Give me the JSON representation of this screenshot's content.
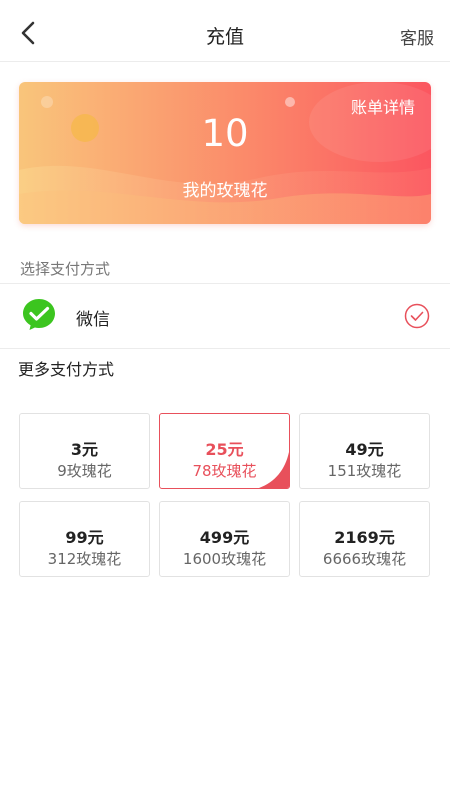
{
  "header": {
    "title": "充值",
    "service_label": "客服"
  },
  "balance": {
    "bill_link": "账单详情",
    "value": "10",
    "label": "我的玫瑰花"
  },
  "payment": {
    "section_label": "选择支付方式",
    "selected_method": "微信",
    "more_label": "更多支付方式"
  },
  "options": [
    {
      "price": "3元",
      "roses": "9玫瑰花",
      "selected": false
    },
    {
      "price": "25元",
      "roses": "78玫瑰花",
      "selected": true
    },
    {
      "price": "49元",
      "roses": "151玫瑰花",
      "selected": false
    },
    {
      "price": "99元",
      "roses": "312玫瑰花",
      "selected": false
    },
    {
      "price": "499元",
      "roses": "1600玫瑰花",
      "selected": false
    },
    {
      "price": "2169元",
      "roses": "6666玫瑰花",
      "selected": false
    }
  ],
  "colors": {
    "accent": "#e8505b",
    "card_gradient_start": "#f8c27a",
    "card_gradient_end": "#fb5a61",
    "wechat_green": "#3cc51f"
  },
  "icons": {
    "back": "chevron-left-icon",
    "wechat": "wechat-icon",
    "check": "check-circle-icon"
  }
}
